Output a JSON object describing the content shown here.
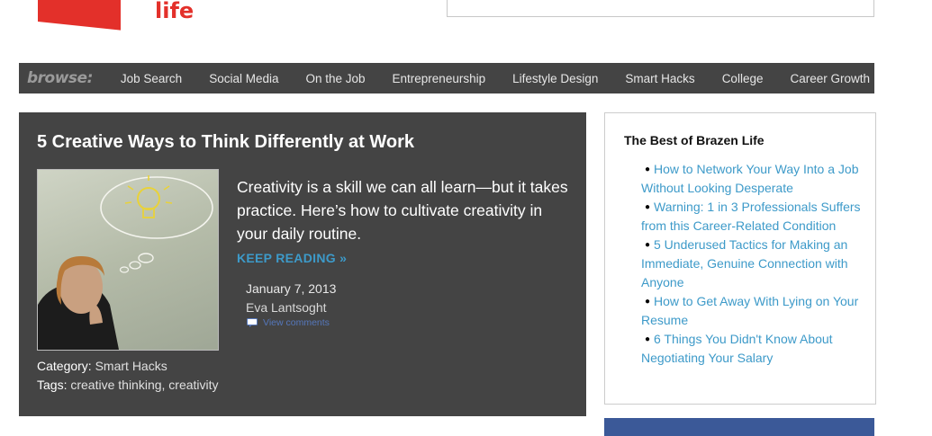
{
  "logo": {
    "text": "life"
  },
  "nav": {
    "browse_label": "browse:",
    "items": [
      "Job Search",
      "Social Media",
      "On the Job",
      "Entrepreneurship",
      "Lifestyle Design",
      "Smart Hacks",
      "College",
      "Career Growth"
    ]
  },
  "post": {
    "title": "5 Creative Ways to Think Differently at Work",
    "excerpt": "Creativity is a skill we can all learn—but it takes practice. Here’s how to cultivate creativity in your daily routine.",
    "keep_reading": "KEEP READING »",
    "date": "January 7, 2013",
    "author": "Eva Lantsoght",
    "comments_label": "View comments",
    "category_label": "Category:",
    "category_value": "Smart Hacks",
    "tags_label": "Tags:",
    "tags_value": "creative thinking, creativity"
  },
  "sidebar": {
    "title": "The Best of Brazen Life",
    "items": [
      "How to Network Your Way Into a Job Without Looking Desperate",
      "Warning: 1 in 3 Professionals Suffers from this Career-Related Condition",
      "5 Underused Tactics for Making an Immediate, Genuine Connection with Anyone",
      "How to Get Away With Lying on Your Resume",
      "6 Things You Didn't Know About Negotiating Your Salary"
    ]
  },
  "colors": {
    "brand_red": "#e3302a",
    "panel_dark": "#444444",
    "link_blue": "#3d9ac9",
    "facebook_blue": "#3b5998"
  }
}
